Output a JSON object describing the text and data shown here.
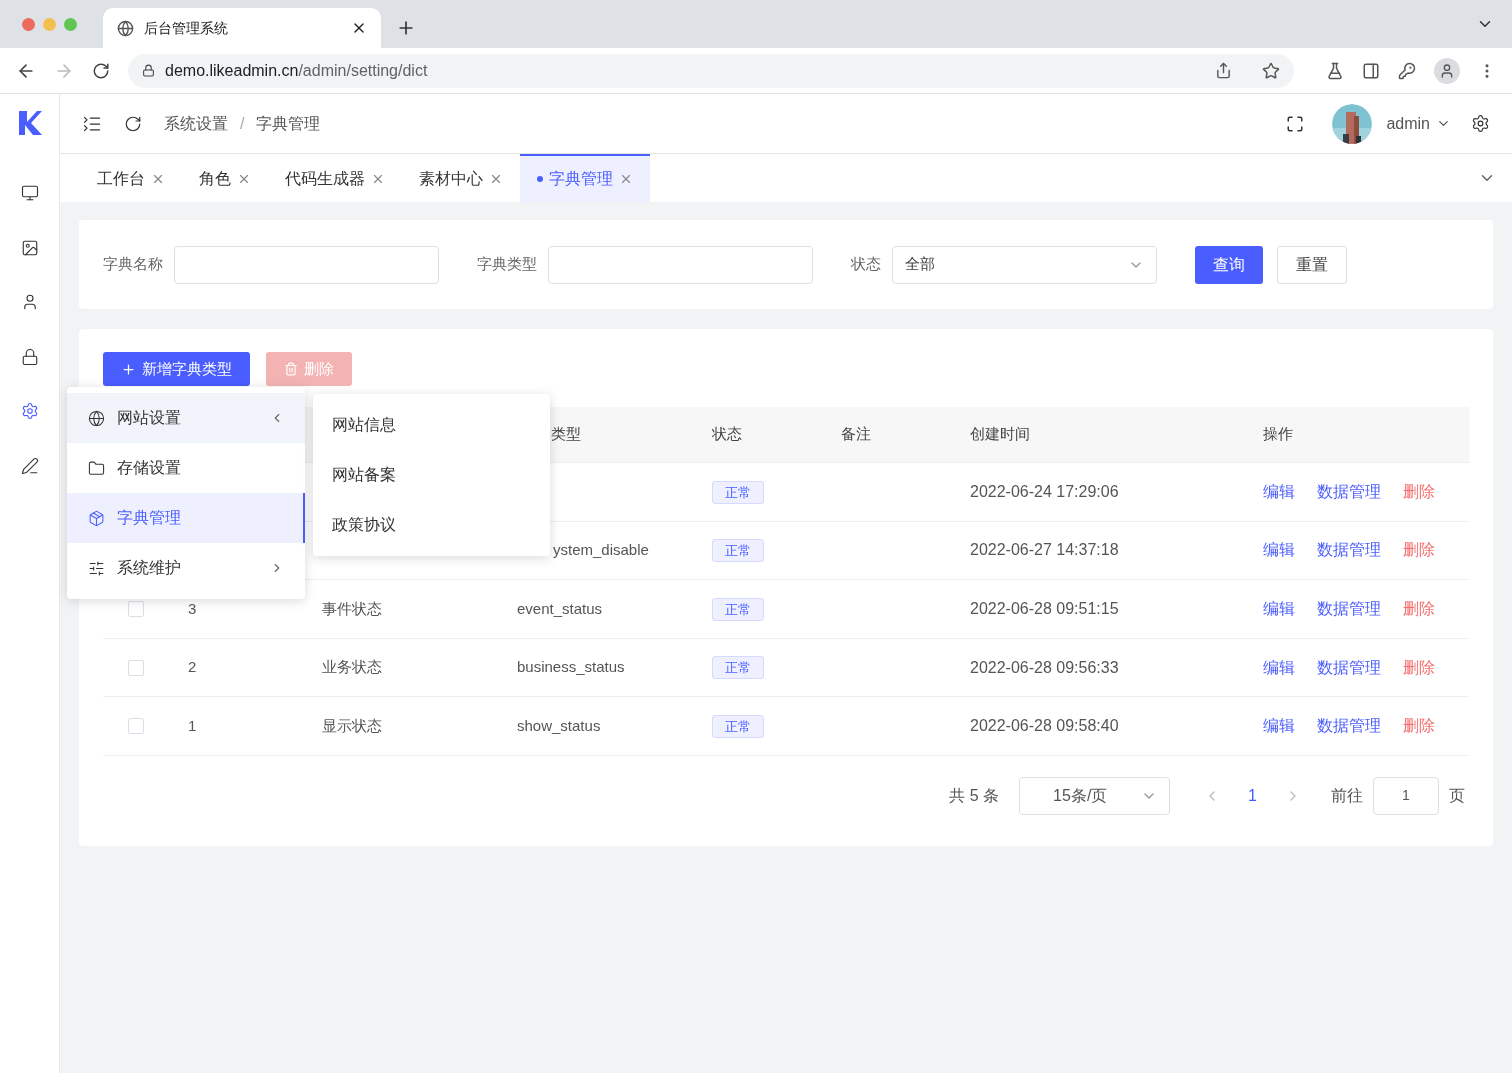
{
  "browser": {
    "tab_title": "后台管理系统",
    "url_host": "demo.likeadmin.cn",
    "url_path": "/admin/setting/dict"
  },
  "header": {
    "breadcrumb": [
      "系统设置",
      "字典管理"
    ],
    "separator": "/",
    "user": "admin"
  },
  "tabs": [
    {
      "label": "工作台",
      "selected": false
    },
    {
      "label": "角色",
      "selected": false
    },
    {
      "label": "代码生成器",
      "selected": false
    },
    {
      "label": "素材中心",
      "selected": false
    },
    {
      "label": "字典管理",
      "selected": true
    }
  ],
  "search": {
    "fields": [
      {
        "label": "字典名称",
        "kind": "input"
      },
      {
        "label": "字典类型",
        "kind": "input"
      },
      {
        "label": "状态",
        "kind": "select",
        "value": "全部"
      }
    ],
    "buttons": [
      {
        "label": "查询",
        "kind": "primary"
      },
      {
        "label": "重置",
        "kind": "plain"
      }
    ]
  },
  "toolbar": {
    "add": "新增字典类型",
    "delete": "删除"
  },
  "table": {
    "columns": [
      "类型",
      "状态",
      "备注",
      "创建时间",
      "操作"
    ],
    "rows": [
      {
        "covered": true,
        "status": "正常",
        "created": "2022-06-24 17:29:06",
        "actions": [
          "编辑",
          "数据管理",
          "删除"
        ]
      },
      {
        "covered": true,
        "type": "ystem_disable",
        "status": "正常",
        "created": "2022-06-27 14:37:18",
        "actions": [
          "编辑",
          "数据管理",
          "删除"
        ]
      },
      {
        "covered": false,
        "checked": false,
        "id": "3",
        "name": "事件状态",
        "type": "event_status",
        "status": "正常",
        "created": "2022-06-28 09:51:15",
        "actions": [
          "编辑",
          "数据管理",
          "删除"
        ]
      },
      {
        "covered": false,
        "checked": false,
        "id": "2",
        "name": "业务状态",
        "type": "business_status",
        "status": "正常",
        "created": "2022-06-28 09:56:33",
        "actions": [
          "编辑",
          "数据管理",
          "删除"
        ]
      },
      {
        "covered": false,
        "checked": false,
        "id": "1",
        "name": "显示状态",
        "type": "show_status",
        "status": "正常",
        "created": "2022-06-28 09:58:40",
        "actions": [
          "编辑",
          "数据管理",
          "删除"
        ]
      }
    ]
  },
  "pagination": {
    "total": "共 5 条",
    "page_size": "15条/页",
    "page": "1",
    "goto": "前往",
    "goto_value": "1",
    "page_unit": "页"
  },
  "menu": {
    "items": [
      {
        "label": "网站设置",
        "expanded": true,
        "selected": false,
        "has_children": true
      },
      {
        "label": "存储设置",
        "expanded": false,
        "selected": false,
        "has_children": false
      },
      {
        "label": "字典管理",
        "expanded": false,
        "selected": true,
        "has_children": false
      },
      {
        "label": "系统维护",
        "expanded": false,
        "selected": false,
        "has_children": true
      }
    ],
    "submenu": [
      "网站信息",
      "网站备案",
      "政策协议"
    ]
  },
  "sidebar": {
    "items": [
      {
        "selected": false
      },
      {
        "selected": false
      },
      {
        "selected": false
      },
      {
        "selected": false
      },
      {
        "selected": true
      },
      {
        "selected": false
      }
    ]
  }
}
